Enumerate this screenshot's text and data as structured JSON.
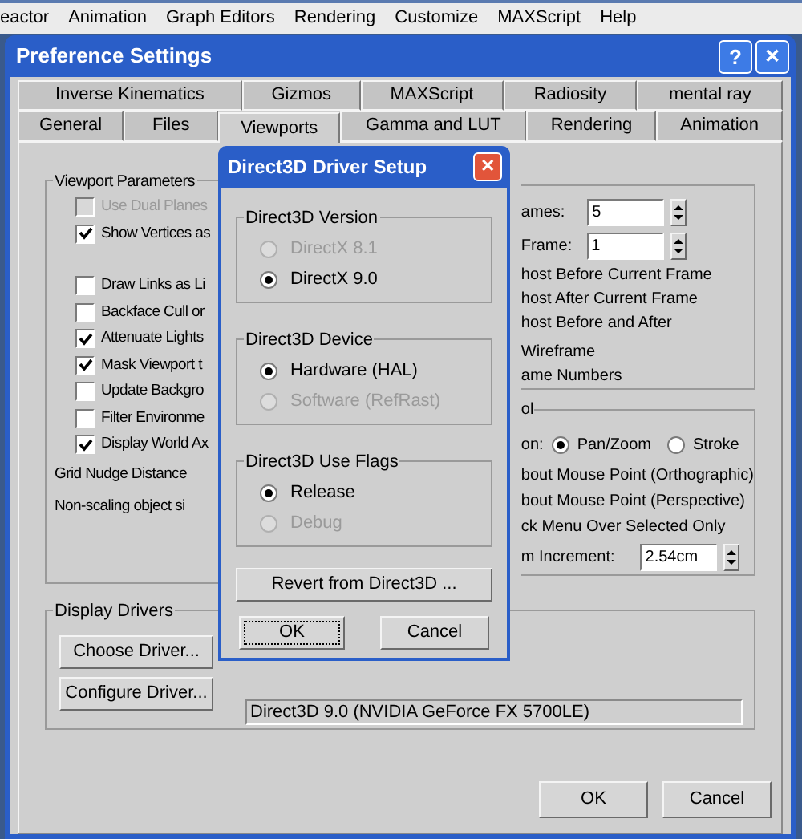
{
  "menu_bar": {
    "items": [
      "eactor",
      "Animation",
      "Graph Editors",
      "Rendering",
      "Customize",
      "MAXScript",
      "Help"
    ]
  },
  "window": {
    "title": "Preference Settings",
    "help_button": "?",
    "close_button": "✕"
  },
  "tabs": [
    [
      {
        "label": "Inverse Kinematics",
        "selected": false
      },
      {
        "label": "Gizmos",
        "selected": false
      },
      {
        "label": "MAXScript",
        "selected": false
      },
      {
        "label": "Radiosity",
        "selected": false
      },
      {
        "label": "mental ray",
        "selected": false
      }
    ],
    [
      {
        "label": "General",
        "selected": false
      },
      {
        "label": "Files",
        "selected": false
      },
      {
        "label": "Viewports",
        "selected": true
      },
      {
        "label": "Gamma and LUT",
        "selected": false
      },
      {
        "label": "Rendering",
        "selected": false
      },
      {
        "label": "Animation",
        "selected": false
      }
    ]
  ],
  "viewport_parameters": {
    "title": "Viewport Parameters",
    "items": [
      {
        "kind": "checkbox",
        "label": "Use Dual Planes",
        "checked": false,
        "disabled": true
      },
      {
        "kind": "checkbox",
        "label": "Show Vertices as",
        "checked": true,
        "disabled": false
      },
      {
        "kind": "gap"
      },
      {
        "kind": "checkbox",
        "label": "Draw Links as Li",
        "checked": false,
        "disabled": false
      },
      {
        "kind": "checkbox",
        "label": "Backface Cull or",
        "checked": false,
        "disabled": false
      },
      {
        "kind": "checkbox",
        "label": "Attenuate Lights",
        "checked": true,
        "disabled": false
      },
      {
        "kind": "checkbox",
        "label": "Mask Viewport t",
        "checked": true,
        "disabled": false
      },
      {
        "kind": "checkbox",
        "label": "Update Backgro",
        "checked": false,
        "disabled": false
      },
      {
        "kind": "checkbox",
        "label": "Filter Environme",
        "checked": false,
        "disabled": false
      },
      {
        "kind": "checkbox",
        "label": "Display World Ax",
        "checked": true,
        "disabled": false
      },
      {
        "kind": "label",
        "label": "Grid Nudge Distance"
      },
      {
        "kind": "label",
        "label": "Non-scaling object si"
      }
    ]
  },
  "ghosting": {
    "items": [
      {
        "kind": "spinner",
        "label": "ames:",
        "value": "5"
      },
      {
        "kind": "spinner",
        "label": "Frame:",
        "value": "1"
      },
      {
        "kind": "text",
        "label": "host Before Current Frame"
      },
      {
        "kind": "text",
        "label": "host After Current Frame"
      },
      {
        "kind": "text",
        "label": "host Before and After"
      },
      {
        "kind": "text",
        "label": "Wireframe"
      },
      {
        "kind": "text",
        "label": "ame Numbers"
      }
    ]
  },
  "mouse_control": {
    "title": "ol",
    "items": [
      {
        "kind": "radios",
        "label": "on:",
        "options": [
          {
            "label": "Pan/Zoom",
            "selected": true
          },
          {
            "label": "Stroke",
            "selected": false
          }
        ]
      },
      {
        "kind": "text",
        "label": "bout Mouse Point (Orthographic)"
      },
      {
        "kind": "text",
        "label": "bout Mouse Point (Perspective)"
      },
      {
        "kind": "text",
        "label": "ck Menu Over Selected Only"
      },
      {
        "kind": "spinner",
        "label": "m Increment:",
        "value": "2.54cm"
      }
    ]
  },
  "display_drivers": {
    "title": "Display Drivers",
    "choose_button": "Choose Driver...",
    "configure_button": "Configure Driver...",
    "driver": "Direct3D 9.0 (NVIDIA GeForce FX 5700LE)"
  },
  "buttons": [
    "OK",
    "Cancel"
  ],
  "direct3d_dialog": {
    "title": "Direct3D Driver Setup",
    "close_button": "✕",
    "groups": [
      {
        "title": "Direct3D Version",
        "options": [
          {
            "label": "DirectX 8.1",
            "selected": false,
            "disabled": true
          },
          {
            "label": "DirectX 9.0",
            "selected": true,
            "disabled": false
          }
        ]
      },
      {
        "title": "Direct3D Device",
        "options": [
          {
            "label": "Hardware (HAL)",
            "selected": true,
            "disabled": false
          },
          {
            "label": "Software (RefRast)",
            "selected": false,
            "disabled": true
          }
        ]
      },
      {
        "title": "Direct3D Use Flags",
        "options": [
          {
            "label": "Release",
            "selected": true,
            "disabled": false
          },
          {
            "label": "Debug",
            "selected": false,
            "disabled": true
          }
        ]
      }
    ],
    "revert_button": "Revert from Direct3D ...",
    "buttons": [
      "OK",
      "Cancel"
    ]
  }
}
